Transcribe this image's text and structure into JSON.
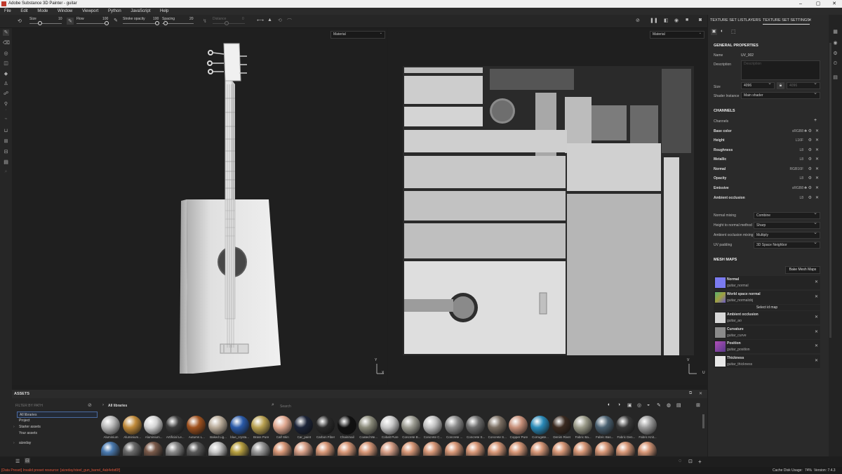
{
  "window": {
    "title": "Adobe Substance 3D Painter - guitar"
  },
  "menu": [
    "File",
    "Edit",
    "Mode",
    "Window",
    "Viewport",
    "Python",
    "JavaScript",
    "Help"
  ],
  "toolbar": {
    "size_label": "Size",
    "size_value": "10",
    "flow_label": "Flow",
    "flow_value": "100",
    "stroke_label": "Stroke opacity",
    "stroke_value": "100",
    "spacing_label": "Spacing",
    "spacing_value": "20",
    "distance_label": "Distance",
    "distance_value": "0"
  },
  "viewport": {
    "left_mode": "Material",
    "right_mode": "Material",
    "axis_y": "Y",
    "axis_x": "X",
    "axis_v": "V",
    "axis_u": "U"
  },
  "right_panel": {
    "tabs": [
      "TEXTURE SET LIST",
      "LAYERS",
      "TEXTURE SET SETTINGS"
    ],
    "general_title": "GENERAL PROPERTIES",
    "name_label": "Name",
    "name_value": "UV_002",
    "desc_label": "Description",
    "desc_placeholder": "Description",
    "size_label": "Size",
    "size_value": "4096",
    "size_value2": "4096",
    "shader_label": "Shader Instance",
    "shader_value": "Main shader",
    "channels_title": "CHANNELS",
    "channels_label": "Channels",
    "channels": [
      {
        "name": "Base color",
        "format": "sRGB8"
      },
      {
        "name": "Height",
        "format": "L16F"
      },
      {
        "name": "Roughness",
        "format": "L8"
      },
      {
        "name": "Metallic",
        "format": "L8"
      },
      {
        "name": "Normal",
        "format": "RGB16F"
      },
      {
        "name": "Opacity",
        "format": "L8"
      },
      {
        "name": "Emissive",
        "format": "sRGB8"
      },
      {
        "name": "Ambient occlusion",
        "format": "L8"
      }
    ],
    "normal_mixing_label": "Normal mixing",
    "normal_mixing_value": "Combine",
    "h2n_label": "Height to normal method",
    "h2n_value": "Sharp",
    "ao_mixing_label": "Ambient occlusion mixing",
    "ao_mixing_value": "Multiply",
    "uv_padding_label": "UV padding",
    "uv_padding_value": "3D Space Neighbor",
    "meshmaps_title": "MESH MAPS",
    "bake_label": "Bake Mesh Maps",
    "select_id_label": "Select id map",
    "meshmaps": [
      {
        "title": "Normal",
        "sub": "guitar_normal",
        "color": "#7b7bf0"
      },
      {
        "title": "World space normal",
        "sub": "guitar_normalobj",
        "color": "#5a9e6a"
      },
      {
        "title": "Ambient occlusion",
        "sub": "guitar_ao",
        "color": "#d8d8d8"
      },
      {
        "title": "Curvature",
        "sub": "guitar_curve",
        "color": "#8a8a8a"
      },
      {
        "title": "Position",
        "sub": "guitar_position",
        "color": "#b04fb8"
      },
      {
        "title": "Thickness",
        "sub": "guitar_thickness",
        "color": "#e8e8e8"
      }
    ]
  },
  "assets": {
    "title": "ASSETS",
    "filter_placeholder": "FILTER BY PATH",
    "libs_crumb": "All libraries",
    "search_placeholder": "Search",
    "libraries": [
      "All libraries",
      "Project",
      "Starter assets",
      "Your assets",
      "aizeday"
    ],
    "row1": [
      {
        "label": "Aluminium",
        "color": "#b8b8b8"
      },
      {
        "label": "Aluminium...",
        "color": "#c08a3a"
      },
      {
        "label": "Aluminium...",
        "color": "#d4d4d4"
      },
      {
        "label": "Artificial Le...",
        "color": "#3a3a3a"
      },
      {
        "label": "Autumn L...",
        "color": "#a0521f"
      },
      {
        "label": "Baked Lig...",
        "color": "#b8aa98"
      },
      {
        "label": "blue_crysta...",
        "color": "#2a5aa8"
      },
      {
        "label": "Brass Pure",
        "color": "#b8a050"
      },
      {
        "label": "Calf Skin",
        "color": "#e0a890"
      },
      {
        "label": "Car_paint",
        "color": "#1c2438"
      },
      {
        "label": "Carbon Fiber",
        "color": "#2a2a2a"
      },
      {
        "label": "Chainmail",
        "color": "#111111"
      },
      {
        "label": "Coated Me...",
        "color": "#8a8a7a"
      },
      {
        "label": "Cobalt Pure",
        "color": "#c8c8c8"
      },
      {
        "label": "Concrete B...",
        "color": "#9a9a90"
      },
      {
        "label": "Concrete C...",
        "color": "#c0c0c0"
      },
      {
        "label": "Concrete ...",
        "color": "#8a8a8a"
      },
      {
        "label": "Concrete S...",
        "color": "#6a6a6a"
      },
      {
        "label": "Concrete S...",
        "color": "#7a6e62"
      },
      {
        "label": "Copper Pure",
        "color": "#c8907a"
      },
      {
        "label": "Corrugate...",
        "color": "#2a8ab8"
      },
      {
        "label": "Denim Rivet",
        "color": "#3a2a20"
      },
      {
        "label": "Fabric Ba...",
        "color": "#9a9a88"
      },
      {
        "label": "Fabric Bas...",
        "color": "#4a6070"
      },
      {
        "label": "Fabric Den...",
        "color": "#383838"
      },
      {
        "label": "Fabric Knit...",
        "color": "#9a9a9a"
      }
    ],
    "row2": [
      "#4a7ab0",
      "#6a6a6a",
      "#7a5a4a",
      "#8a8a8a",
      "#5a5a5a",
      "#c8c8c8",
      "#b8a040",
      "#9a9a9a",
      "#d89878",
      "#d8a088",
      "#d89878",
      "#d89878",
      "#d89878",
      "#d8a088",
      "#d89878",
      "#d89878",
      "#d89878",
      "#d89878",
      "#d89878",
      "#d89878",
      "#d89878",
      "#d89878",
      "#d89878",
      "#d89878",
      "#d89878",
      "#d89878"
    ]
  },
  "status": {
    "message": "[Data Preset] Invalid preset resource: [aizeday/steel_gun_barrel_4ab4ebd0f]",
    "cache": "Cache Disk Usage:",
    "percent": "74%",
    "version": "Version: 7.4.3"
  }
}
